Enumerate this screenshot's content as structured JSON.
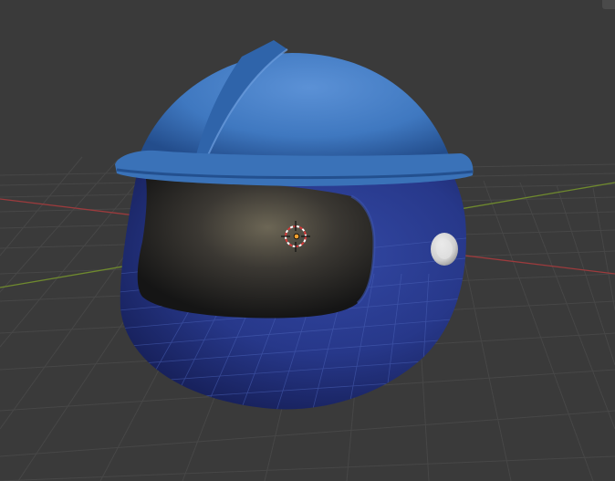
{
  "viewport": {
    "mode": "3D Viewport",
    "view": "perspective",
    "shading": "solid",
    "overlays": {
      "grid_floor": true,
      "axis_x": true,
      "axis_y": true,
      "3d_cursor": true,
      "origin_point": true
    }
  },
  "scene": {
    "object": "helmet",
    "parts": [
      "helmet-shell",
      "helmet-dome",
      "helmet-brim",
      "helmet-ridge",
      "helmet-visor-opening",
      "helmet-side-button"
    ],
    "object_mode": "mesh"
  },
  "colors": {
    "background": "#393939",
    "grid_line": "#4a4a4a",
    "axis_x": "#9c3b3d",
    "axis_y": "#6f8a2e",
    "dome": "#3f78c0",
    "shell": "#27388a",
    "interior": "#1f1f1f",
    "button": "#d8d8d8",
    "cursor_red": "#c83232",
    "origin": "#f0a030"
  },
  "icons": {
    "cursor": "3d-cursor-icon",
    "origin": "object-origin-icon"
  }
}
